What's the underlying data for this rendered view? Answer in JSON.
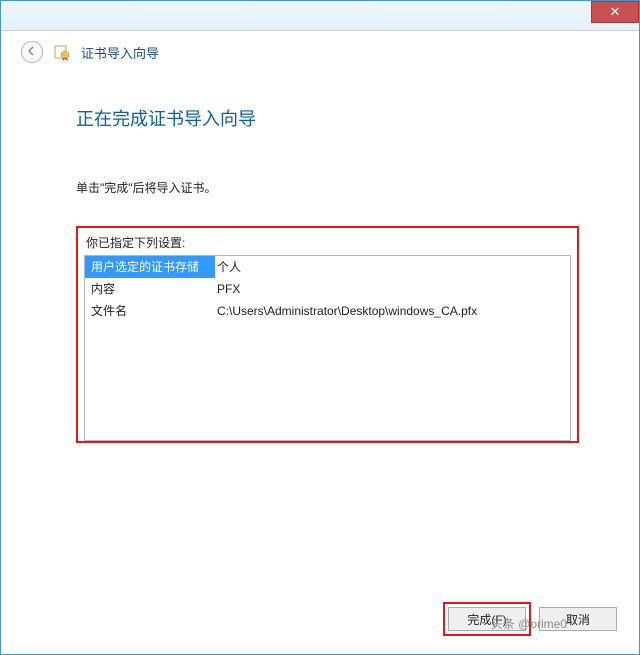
{
  "header": {
    "wizard_title": "证书导入向导"
  },
  "page": {
    "title": "正在完成证书导入向导",
    "instruction": "单击\"完成\"后将导入证书。",
    "settings_label": "你已指定下列设置:"
  },
  "settings": {
    "rows": [
      {
        "key": "用户选定的证书存储",
        "value": "个人"
      },
      {
        "key": "内容",
        "value": "PFX"
      },
      {
        "key": "文件名",
        "value": "C:\\Users\\Administrator\\Desktop\\windows_CA.pfx"
      }
    ]
  },
  "buttons": {
    "finish": "完成(F)",
    "cancel": "取消"
  },
  "watermark": "头条 @orime0"
}
